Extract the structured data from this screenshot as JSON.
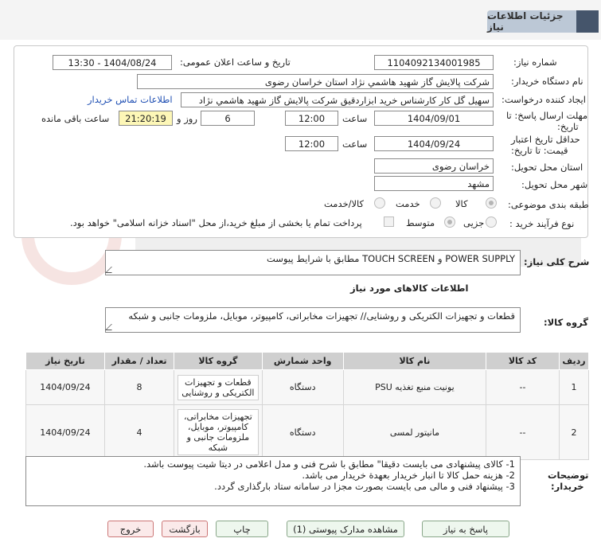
{
  "header": {
    "title": "جزئیات اطلاعات نیاز"
  },
  "form": {
    "need_number_label": "شماره نیاز:",
    "need_number": "1104092134001985",
    "announce_label": "تاریخ و ساعت اعلان عمومی:",
    "announce_value": "1404/08/24 - 13:30",
    "buyer_org_label": "نام دستگاه خریدار:",
    "buyer_org": "شرکت پالايش گاز شهيد هاشمي نژاد   استان خراسان رضوی",
    "requester_label": "ایجاد کننده درخواست:",
    "requester": "سهیل گل کار کارشناس خرید ابزاردقیق شرکت پالايش گاز شهيد هاشمي نژاد",
    "contact_link": "اطلاعات تماس خریدار",
    "deadline_label_1": "مهلت ارسال پاسخ: تا",
    "deadline_label_2": "تاریخ:",
    "deadline_date": "1404/09/01",
    "time_label": "ساعت",
    "deadline_time": "12:00",
    "days_value": "6",
    "days_label": "روز و",
    "remaining_time": "21:20:19",
    "remaining_label": "ساعت باقی مانده",
    "validity_label_1": "حداقل تاریخ اعتبار",
    "validity_label_2": "قیمت: تا تاریخ:",
    "validity_date": "1404/09/24",
    "validity_time": "12:00",
    "province_label": "استان محل تحویل:",
    "province": "خراسان رضوی",
    "city_label": "شهر محل تحویل:",
    "city": "مشهد",
    "category_label": "طبقه بندی موضوعی:",
    "category_options": [
      "کالا",
      "خدمت",
      "کالا/خدمت"
    ],
    "process_label": "نوع فرآیند خرید :",
    "process_options": [
      "جزیی",
      "متوسط"
    ],
    "payment_note": "پرداخت تمام یا بخشی از مبلغ خرید،از محل \"اسناد خزانه اسلامی\" خواهد بود."
  },
  "summary": {
    "label": "شرح کلی نیاز:",
    "value": "POWER SUPPLY و TOUCH SCREEN مطابق با شرایط پیوست"
  },
  "goods_info_title": "اطلاعات کالاهای مورد نیاز",
  "goods_group": {
    "label": "گروه کالا:",
    "value": "قطعات و تجهیزات الکتریکی و روشنایی// تجهیزات مخابراتی، کامپیوتر، موبایل، ملزومات جانبی و شبکه"
  },
  "table": {
    "headers": [
      "ردیف",
      "کد کالا",
      "نام کالا",
      "واحد شمارش",
      "گروه کالا",
      "تعداد / مقدار",
      "تاریخ نیاز"
    ],
    "rows": [
      [
        "1",
        "--",
        "یونیت منبع تغذیه PSU",
        "دستگاه",
        "قطعات و تجهیزات الکتریکی و روشنایی",
        "8",
        "1404/09/24"
      ],
      [
        "2",
        "--",
        "مانیتور لمسی",
        "دستگاه",
        "تجهیزات مخابراتی، کامپیوتر، موبایل، ملزومات جانبی و شبکه",
        "4",
        "1404/09/24"
      ]
    ]
  },
  "notes": {
    "label_1": "توضیحات",
    "label_2": "خریدار:",
    "lines": [
      "1-   کالای پیشنهادی می بایست دقیقا\" مطابق با شرح فنی و مدل اعلامی در دیتا شیت پیوست باشد.",
      "2-   هزینه حمل کالا تا انبار خریدار بعهدة خریدار می باشد.",
      "3-   پیشنهاد فنی و مالی می بایست بصورت مجزا در سامانه ستاد بارگذاری گردد."
    ]
  },
  "buttons": {
    "reply": "پاسخ به نیاز",
    "docs": "مشاهده مدارک پیوستی (1)",
    "print": "چاپ",
    "back": "بازگشت",
    "exit": "خروج"
  },
  "colors": {
    "header_bg": "#bcc8d6",
    "header_accent": "#45556b",
    "link": "#1f4fb3",
    "highlight": "#fdf7b7"
  }
}
